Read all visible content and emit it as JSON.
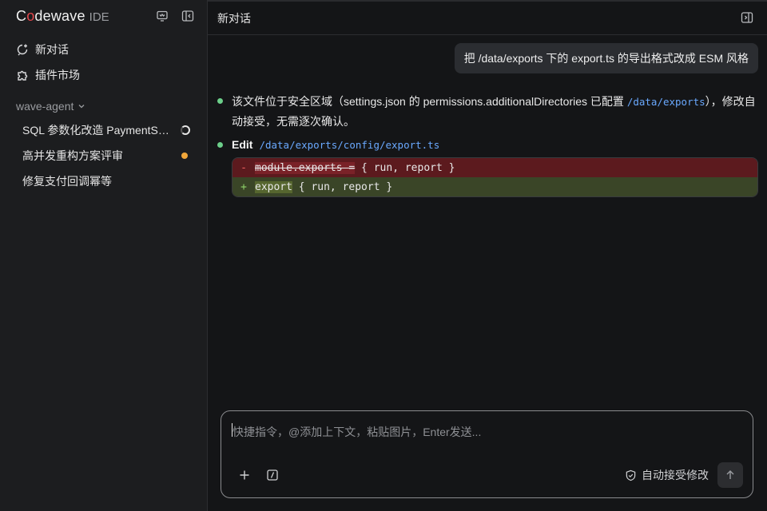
{
  "sidebar": {
    "brand_main_c": "C",
    "brand_main_o": "o",
    "brand_main_rest": "dewave",
    "brand_ide": "IDE",
    "nav": [
      {
        "label": "新对话",
        "icon": "new-chat-icon"
      },
      {
        "label": "插件市场",
        "icon": "puzzle-icon"
      }
    ],
    "group_label": "wave-agent",
    "sessions": [
      {
        "label": "SQL 参数化改造 PaymentService",
        "status": "running"
      },
      {
        "label": "高并发重构方案评审",
        "status": "unread"
      },
      {
        "label": "修复支付回调幂等",
        "status": "none"
      }
    ]
  },
  "header": {
    "title": "新对话"
  },
  "conversation": {
    "user_message": "把 /data/exports 下的 export.ts 的导出格式改成 ESM 风格",
    "assistant_text_before": "该文件位于安全区域（settings.json 的 permissions.additionalDirectories 已配置 ",
    "assistant_code": "/data/exports",
    "assistant_text_after": "），修改自动接受，无需逐次确认。",
    "edit_label": "Edit",
    "edit_path": "/data/exports/config/export.ts",
    "diff": {
      "removed_sign": "-",
      "removed_struck": "module.exports =",
      "removed_rest": " { run, report }",
      "added_sign": "+",
      "added_highlight": "export",
      "added_rest": " { run, report }"
    }
  },
  "composer": {
    "placeholder": "快捷指令，@添加上下文，粘贴图片，Enter发送...",
    "auto_accept_label": "自动接受修改"
  },
  "colors": {
    "accent_red": "#e5484d",
    "status_green": "#6ccf8a",
    "status_orange": "#f0a63a",
    "path_blue": "#6aa9ff"
  }
}
